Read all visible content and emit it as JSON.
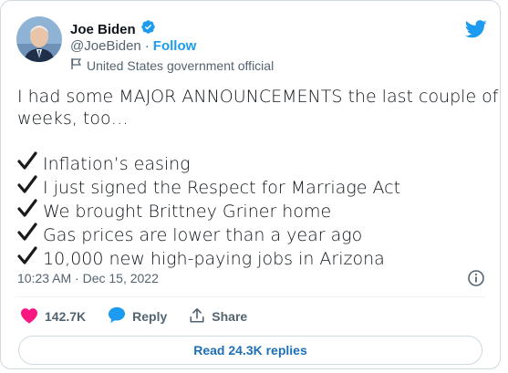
{
  "author": {
    "display_name": "Joe Biden",
    "handle": "@JoeBiden",
    "separator": "·",
    "follow_label": "Follow",
    "label": "United States government official",
    "verified": true
  },
  "tweet": {
    "intro_line1": "I had some MAJOR ANNOUNCEMENTS the last couple of",
    "intro_line2": "weeks, too…",
    "items": [
      "Inflation’s easing",
      "I just signed the Respect for Marriage Act",
      "We brought Brittney Griner home",
      "Gas prices are lower than a year ago",
      "10,000 new high-paying jobs in Arizona"
    ],
    "timestamp": "10:23 AM · Dec 15, 2022"
  },
  "actions": {
    "likes": "142.7K",
    "reply_label": "Reply",
    "share_label": "Share"
  },
  "replies_button": "Read 24.3K replies",
  "colors": {
    "accent": "#1d9bf0",
    "like": "#f91880",
    "text": "#0f1419",
    "muted": "#536471",
    "border": "#cfd9de"
  },
  "icons": {
    "verified": "verified-badge-icon",
    "gov": "flag-icon",
    "logo": "twitter-bird-icon",
    "check": "check-mark-icon",
    "info": "info-icon",
    "like": "heart-icon",
    "reply": "speech-bubble-icon",
    "share": "share-icon"
  }
}
